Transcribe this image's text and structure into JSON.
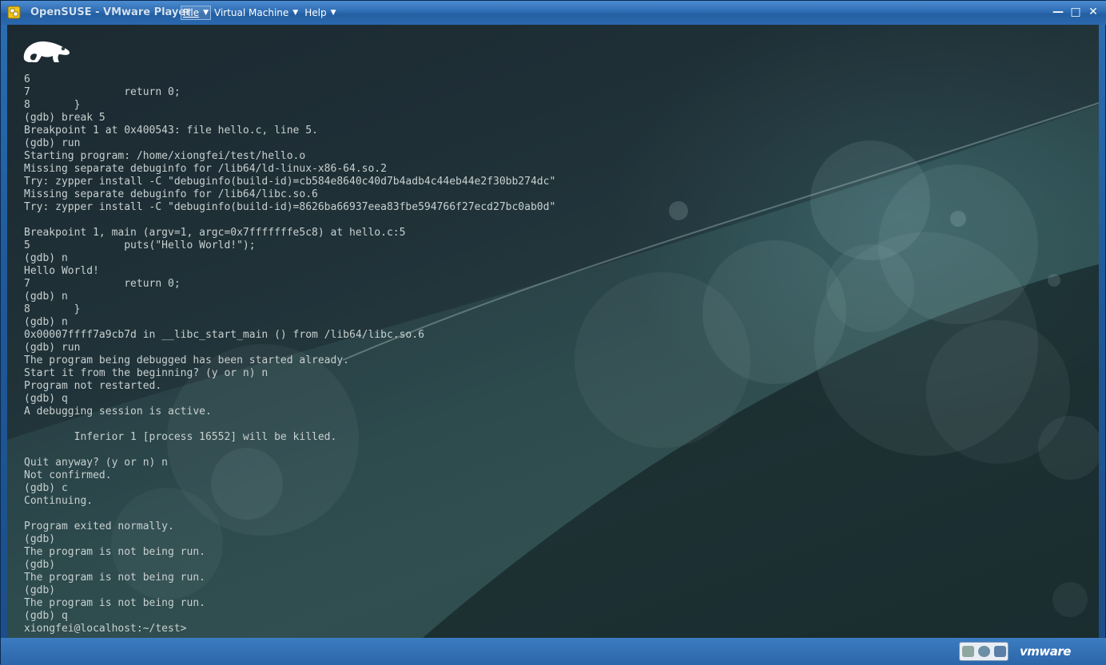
{
  "window": {
    "title": "OpenSUSE - VMware Player",
    "menus": [
      {
        "label": "File"
      },
      {
        "label": "Virtual Machine"
      },
      {
        "label": "Help"
      }
    ],
    "controls": {
      "minimize": "—",
      "maximize": "□",
      "close": "✕"
    }
  },
  "terminal": {
    "lines": [
      "6",
      "7               return 0;",
      "8       }",
      "(gdb) break 5",
      "Breakpoint 1 at 0x400543: file hello.c, line 5.",
      "(gdb) run",
      "Starting program: /home/xiongfei/test/hello.o",
      "Missing separate debuginfo for /lib64/ld-linux-x86-64.so.2",
      "Try: zypper install -C \"debuginfo(build-id)=cb584e8640c40d7b4adb4c44eb44e2f30bb274dc\"",
      "Missing separate debuginfo for /lib64/libc.so.6",
      "Try: zypper install -C \"debuginfo(build-id)=8626ba66937eea83fbe594766f27ecd27bc0ab0d\"",
      "",
      "Breakpoint 1, main (argv=1, argc=0x7fffffffe5c8) at hello.c:5",
      "5               puts(\"Hello World!\");",
      "(gdb) n",
      "Hello World!",
      "7               return 0;",
      "(gdb) n",
      "8       }",
      "(gdb) n",
      "0x00007ffff7a9cb7d in __libc_start_main () from /lib64/libc.so.6",
      "(gdb) run",
      "The program being debugged has been started already.",
      "Start it from the beginning? (y or n) n",
      "Program not restarted.",
      "(gdb) q",
      "A debugging session is active.",
      "",
      "        Inferior 1 [process 16552] will be killed.",
      "",
      "Quit anyway? (y or n) n",
      "Not confirmed.",
      "(gdb) c",
      "Continuing.",
      "",
      "Program exited normally.",
      "(gdb)",
      "The program is not being run.",
      "(gdb)",
      "The program is not being run.",
      "(gdb)",
      "The program is not being run.",
      "(gdb) q",
      "xiongfei@localhost:~/test>"
    ]
  },
  "statusbar": {
    "brand": "vmware"
  },
  "colors": {
    "titlebar": "#2e6db3",
    "terminal_text": "#c8d0d0",
    "desktop": "#2d4a4d"
  }
}
